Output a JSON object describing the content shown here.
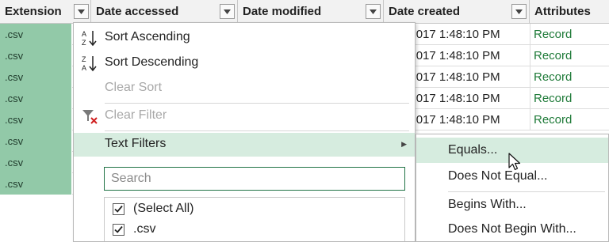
{
  "columns": [
    {
      "label": "Extension",
      "has_filter": true
    },
    {
      "label": "Date accessed",
      "has_filter": true
    },
    {
      "label": "Date modified",
      "has_filter": true
    },
    {
      "label": "Date created",
      "has_filter": true
    },
    {
      "label": "Attributes",
      "has_filter": false
    }
  ],
  "rows": [
    {
      "extension": ".csv",
      "date_created": "4/05/2017 1:48:10 PM",
      "attributes": "Record"
    },
    {
      "extension": ".csv",
      "date_created": "4/05/2017 1:48:10 PM",
      "attributes": "Record"
    },
    {
      "extension": ".csv",
      "date_created": "4/05/2017 1:48:10 PM",
      "attributes": "Record"
    },
    {
      "extension": ".csv",
      "date_created": "4/05/2017 1:48:10 PM",
      "attributes": "Record"
    },
    {
      "extension": ".csv",
      "date_created": "4/05/2017 1:48:10 PM",
      "attributes": "Record"
    },
    {
      "extension": ".csv",
      "date_created": "",
      "attributes": ""
    },
    {
      "extension": ".csv",
      "date_created": "",
      "attributes": ""
    },
    {
      "extension": ".csv",
      "date_created": "",
      "attributes": ""
    }
  ],
  "menu": {
    "sort_ascending": "Sort Ascending",
    "sort_descending": "Sort Descending",
    "clear_sort": "Clear Sort",
    "clear_filter": "Clear Filter",
    "text_filters": "Text Filters",
    "search_placeholder": "Search",
    "list_items": [
      {
        "label": "(Select All)",
        "checked": true
      },
      {
        "label": ".csv",
        "checked": true
      }
    ]
  },
  "submenu": {
    "equals": "Equals...",
    "does_not_equal": "Does Not Equal...",
    "begins_with": "Begins With...",
    "does_not_begin_with": "Does Not Begin With..."
  },
  "colors": {
    "extension_fill": "#92c9a8",
    "hover_fill": "#d6ecdf",
    "record_text": "#1e7a38",
    "search_border": "#217346"
  }
}
